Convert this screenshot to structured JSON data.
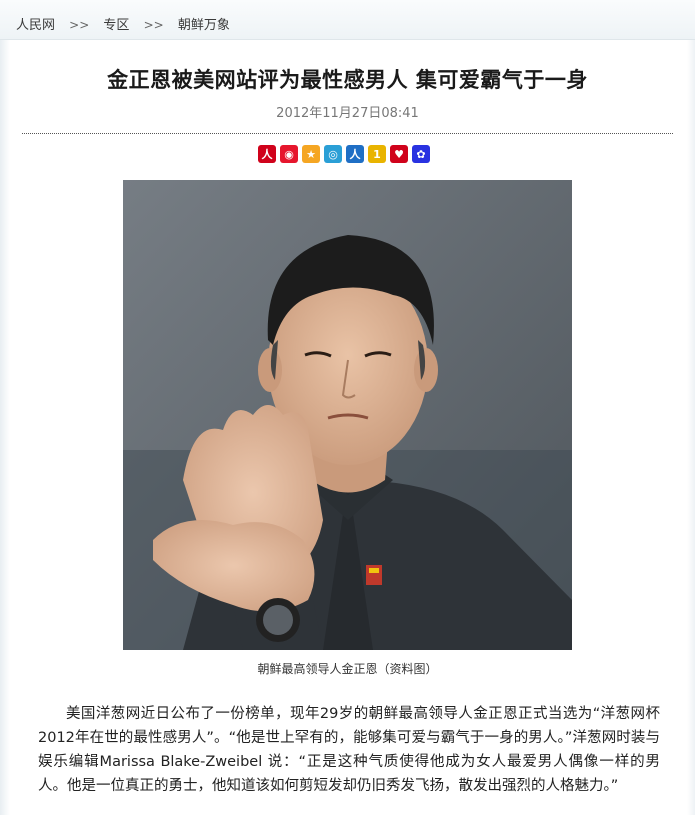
{
  "breadcrumb": {
    "items": [
      "人民网",
      "专区",
      "朝鲜万象"
    ],
    "separator": ">>"
  },
  "article": {
    "title": "金正恩被美网站评为最性感男人 集可爱霸气于一身",
    "date": "2012年11月27日08:41",
    "image_alt": "金正恩",
    "caption": "朝鲜最高领导人金正恩（资料图）",
    "body": "美国洋葱网近日公布了一份榜单，现年29岁的朝鲜最高领导人金正恩正式当选为“洋葱网杯2012年在世的最性感男人”。“他是世上罕有的，能够集可爱与霸气于一身的男人。”洋葱网时装与娱乐编辑Marissa Blake-Zweibel 说：“正是这种气质使得他成为女人最爱男人偶像一样的男人。他是一位真正的勇士，他知道该如何剪短发却仍旧秀发飞扬，散发出强烈的人格魅力。”"
  },
  "share_icons": [
    {
      "name": "people-share-icon",
      "glyph": "人",
      "color": "#d0021b"
    },
    {
      "name": "weibo-icon",
      "glyph": "◉",
      "color": "#e6162d"
    },
    {
      "name": "qzone-icon",
      "glyph": "★",
      "color": "#f5a623"
    },
    {
      "name": "tencent-weibo-icon",
      "glyph": "◎",
      "color": "#2a9fd6"
    },
    {
      "name": "renren-icon",
      "glyph": "人",
      "color": "#1f6fc5"
    },
    {
      "name": "kaixin-icon",
      "glyph": "1",
      "color": "#e9b400"
    },
    {
      "name": "douban-icon",
      "glyph": "♥",
      "color": "#d0021b"
    },
    {
      "name": "baidu-icon",
      "glyph": "✿",
      "color": "#2932e1"
    }
  ]
}
